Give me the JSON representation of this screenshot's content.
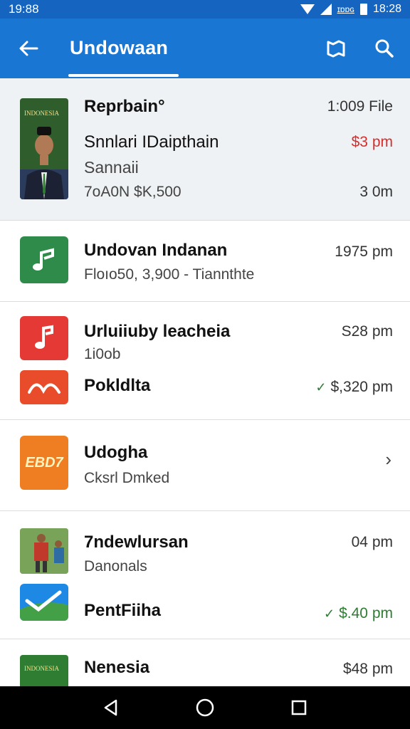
{
  "status_bar": {
    "time": "19:88",
    "indicator": "ɪɒɒɢ",
    "clock_right": "18:28"
  },
  "app_bar": {
    "title": "Undowaan",
    "back_icon": "arrow-left-icon",
    "map_icon": "map-icon",
    "search_icon": "search-icon",
    "background": "#1976d2"
  },
  "items": [
    {
      "title": "Reprbain°",
      "subtitle": "Snnlari IDaipthain",
      "line3": "Sannaii",
      "line4": "7oA0N $K,500",
      "meta1": "1:009 File",
      "meta2": "$3 pm",
      "meta3": "3 0m",
      "thumb_text": "INDONESIA"
    },
    {
      "title": "Undovan Indanan",
      "subtitle": "Floıo50, 3,900 - Tiannthte",
      "meta1": "1975 pm",
      "icon": "music-note-icon",
      "color": "#2e8b4a"
    },
    {
      "title": "Urluiiuby leacheia",
      "subtitle": "1i0ob",
      "meta1": "S28 pm",
      "icon": "music-note-icon",
      "color": "#e53935",
      "title2": "Pokldlta",
      "meta2": "$,320 pm",
      "icon2": "wave-logo-icon",
      "color2": "#e84c2a"
    },
    {
      "title": "Udogha",
      "subtitle": "Cksrl Dmked",
      "icon": "ebd-badge-icon",
      "icon_text": "EBD7",
      "color": "#ef7d22"
    },
    {
      "title": "7ndewlursan",
      "subtitle": "Danonals",
      "meta1": "04 pm",
      "title2": "PentFiiha",
      "meta2": "$.40 pm",
      "icon2": "swoosh-logo-icon",
      "color2": "#1e88e5"
    },
    {
      "title": "Nenesia",
      "meta1": "$48 pm",
      "thumb_text": "INDONESIA"
    }
  ],
  "nav": {
    "back_icon": "nav-back-icon",
    "home_icon": "nav-home-icon",
    "recents_icon": "nav-recents-icon"
  }
}
